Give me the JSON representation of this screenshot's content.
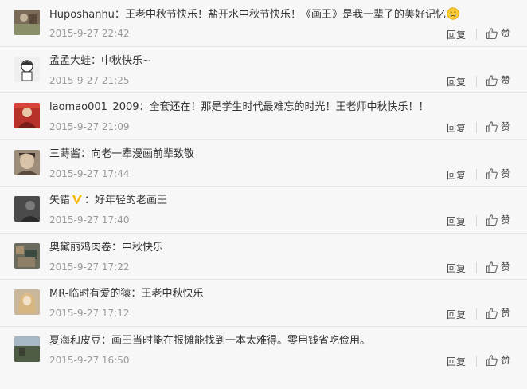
{
  "comments": [
    {
      "username": "Huposhanhu",
      "separator": "：",
      "text": "王老中秋节快乐！盐开水中秋节快乐！《画王》是我一辈子的美好记忆",
      "emoji": "crying-face-icon",
      "time": "2015-9-27 22:42",
      "reply": "回复",
      "like": "赞",
      "avatar_color": "#7a6a5a"
    },
    {
      "username": "孟孟大蛙",
      "separator": "：",
      "text": "中秋快乐~",
      "time": "2015-9-27 21:25",
      "reply": "回复",
      "like": "赞",
      "avatar_color": "#efefef"
    },
    {
      "username": "laomao001_2009",
      "separator": "：",
      "text": "全套还在！那是学生时代最难忘的时光！王老师中秋快乐！！",
      "time": "2015-9-27 21:09",
      "reply": "回复",
      "like": "赞",
      "avatar_color": "#b8322a"
    },
    {
      "username": "三蒔酱",
      "separator": "：",
      "text": "向老一辈漫画前辈致敬",
      "time": "2015-9-27 17:44",
      "reply": "回复",
      "like": "赞",
      "avatar_color": "#9c8c7a"
    },
    {
      "username": "矢错",
      "separator": "：",
      "text": "好年轻的老画王",
      "verified": true,
      "time": "2015-9-27 17:40",
      "reply": "回复",
      "like": "赞",
      "avatar_color": "#4a4a4a"
    },
    {
      "username": "奥黛丽鸡肉卷",
      "separator": "：",
      "text": "中秋快乐",
      "time": "2015-9-27 17:22",
      "reply": "回复",
      "like": "赞",
      "avatar_color": "#6b6b5e"
    },
    {
      "username": "MR-临时有爱的猿",
      "separator": "：",
      "text": "王老中秋快乐",
      "time": "2015-9-27 17:12",
      "reply": "回复",
      "like": "赞",
      "avatar_color": "#c9b79c"
    },
    {
      "username": "夏海和皮豆",
      "separator": "：",
      "text": "画王当时能在报摊能找到一本太难得。零用钱省吃俭用。",
      "time": "2015-9-27 16:50",
      "reply": "回复",
      "like": "赞",
      "avatar_color": "#5e6b52"
    }
  ],
  "colors": {
    "background": "#f7f7f7",
    "text": "#333333",
    "timestamp": "#999999",
    "verified_badge": "#f5b800"
  }
}
